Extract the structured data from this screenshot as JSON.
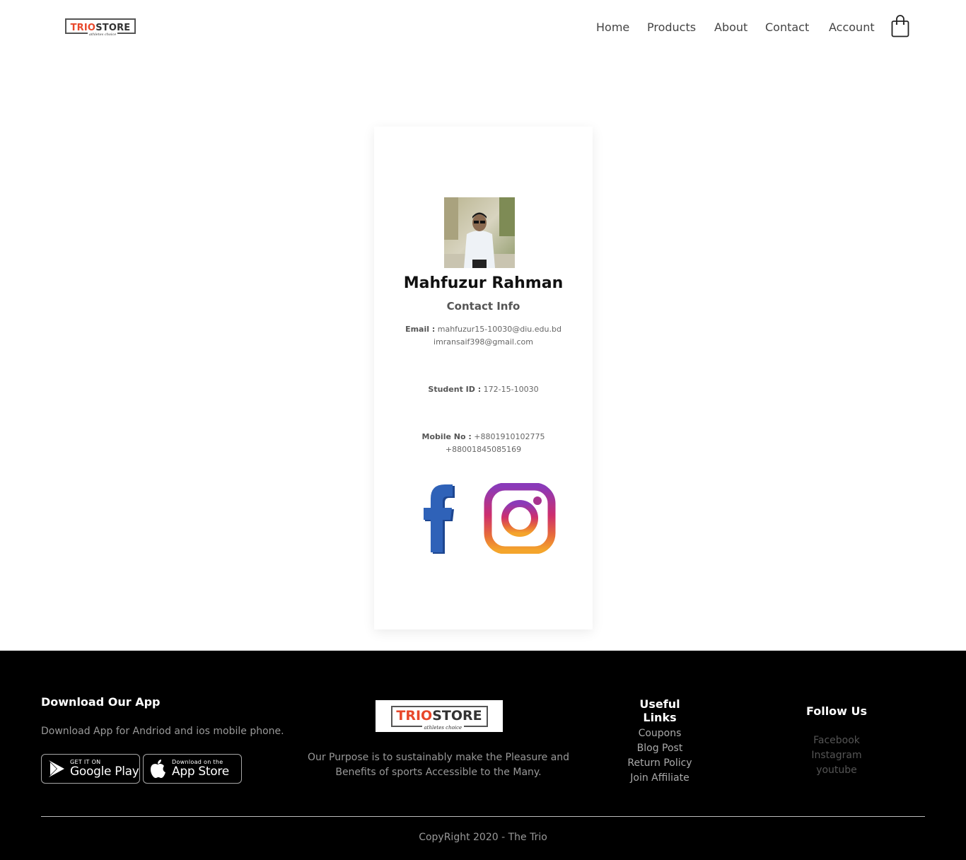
{
  "header": {
    "logo": {
      "trio": "TRIO",
      "store": "STORE",
      "tagline": "athletes choice"
    },
    "nav": [
      "Home",
      "Products",
      "About",
      "Contact",
      "Account"
    ],
    "cart_icon": "shopping-bag-icon"
  },
  "profile": {
    "name": "Mahfuzur Rahman",
    "subtitle": "Contact Info",
    "email_label": "Email :",
    "email_1": "mahfuzur15-10030@diu.edu.bd",
    "email_2": "imransaif398@gmail.com",
    "student_label": "Student ID :",
    "student_id": "172-15-10030",
    "mobile_label": "Mobile No :",
    "mobile_1": "+8801910102775",
    "mobile_2": "+88001845085169",
    "social_icons": [
      "facebook-icon",
      "instagram-icon"
    ]
  },
  "footer": {
    "app": {
      "title": "Download Our App",
      "text": "Download App for Andriod and ios mobile phone.",
      "google_small": "GET IT ON",
      "google_big": "Google Play",
      "apple_small": "Download on the",
      "apple_big": "App Store"
    },
    "logo": {
      "trio": "TRIO",
      "store": "STORE",
      "tagline": "athletes choice"
    },
    "purpose_1": "Our Purpose is to sustainably make the Pleasure and",
    "purpose_2": "Benefits of sports Accessible to the Many.",
    "useful": {
      "title": "Useful Links",
      "links": [
        "Coupons",
        "Blog Post",
        "Return Policy",
        "Join Affiliate"
      ]
    },
    "follow": {
      "title": "Follow Us",
      "links": [
        "Facebook",
        "Instagram",
        "youtube"
      ]
    },
    "copyright": "CopyRight 2020 - The Trio"
  },
  "colors": {
    "accent": "#e8472a",
    "footer_bg": "#000000",
    "facebook": "#2a5aa8"
  }
}
